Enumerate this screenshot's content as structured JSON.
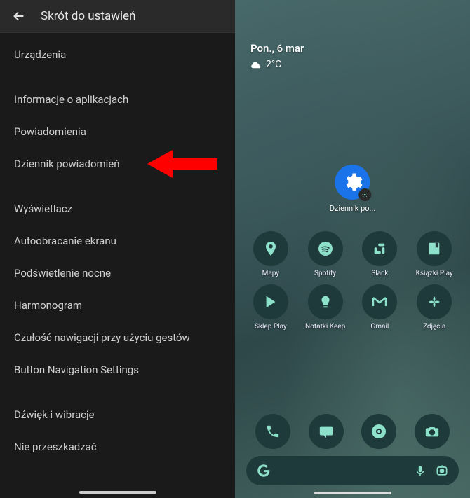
{
  "header": {
    "title": "Skrót do ustawień"
  },
  "settings_items": [
    "Urządzenia",
    "",
    "Informacje o aplikacjach",
    "Powiadomienia",
    "Dziennik powiadomień",
    "",
    "Wyświetlacz",
    "Autoobracanie ekranu",
    "Podświetlenie nocne",
    "Harmonogram",
    "Czułość nawigacji przy użyciu gestów",
    "Button Navigation Settings",
    "",
    "Dźwięk i wibracje",
    "Nie przeszkadzać"
  ],
  "home": {
    "date": "Pon., 6 mar",
    "temp": "2°C",
    "shortcut_label": "Dziennik po...",
    "apps_row1": [
      "Mapy",
      "Spotify",
      "Slack",
      "Książki Play"
    ],
    "apps_row2": [
      "Sklep Play",
      "Notatki Keep",
      "Gmail",
      "Zdjęcia"
    ]
  },
  "colors": {
    "accent": "#8de0c9",
    "arrow": "#ff0000"
  }
}
